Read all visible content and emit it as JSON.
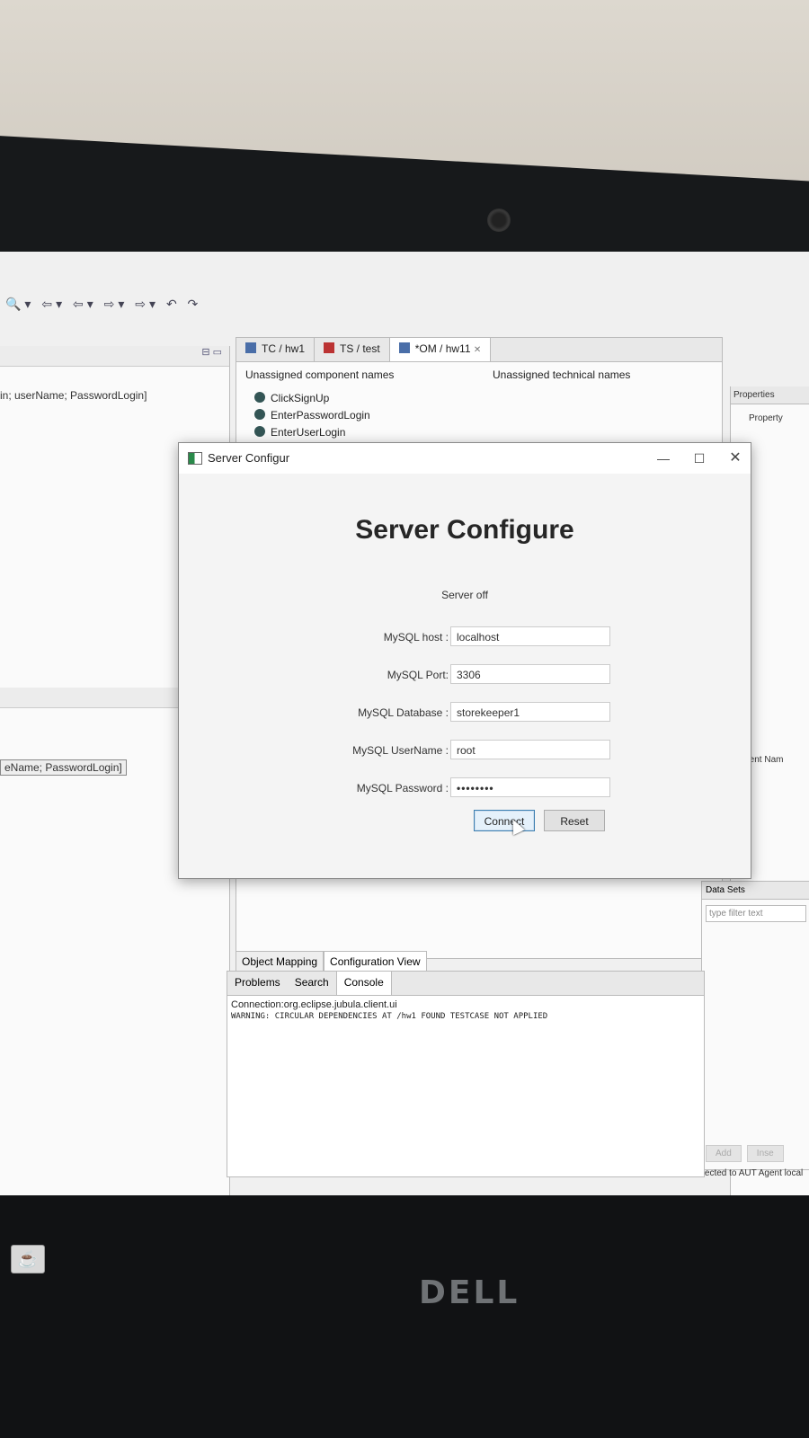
{
  "ide": {
    "left_panel": {
      "text_top": "in; userName; PasswordLogin]",
      "text_bottom": "eName; PasswordLogin]"
    },
    "editor_tabs": [
      {
        "label": "TC / hw1"
      },
      {
        "label": "TS / test"
      },
      {
        "label": "*OM / hw11",
        "close": "✕"
      }
    ],
    "unassigned_component_names": "Unassigned component names",
    "unassigned_technical_names": "Unassigned technical names",
    "components": [
      "ClickSignUp",
      "EnterPasswordLogin",
      "EnterUserLogin"
    ],
    "properties_tab": "Properties",
    "property_header": "Property",
    "component_name_partial": "ponent Nam",
    "bottom_tabs": [
      "Object Mapping",
      "Configuration View"
    ],
    "console_tabs": [
      "Problems",
      "Search",
      "Console"
    ],
    "console_line1": "Connection:org.eclipse.jubula.client.ui",
    "console_line2": "WARNING: CIRCULAR DEPENDENCIES AT /hw1 FOUND TESTCASE NOT APPLIED",
    "data_sets": {
      "title": "Data Sets",
      "filter_placeholder": "type filter text",
      "add_label": "Add",
      "insert_label": "Inse"
    },
    "status_text": "Connected to AUT Agent local"
  },
  "dialog": {
    "window_title": "Server Configur",
    "heading": "Server Configure",
    "status": "Server off",
    "fields": [
      {
        "label": "MySQL host :",
        "value": "localhost"
      },
      {
        "label": "MySQL Port:",
        "value": "3306"
      },
      {
        "label": "MySQL Database :",
        "value": "storekeeper1"
      },
      {
        "label": "MySQL UserName :",
        "value": "root"
      },
      {
        "label": "MySQL Password :",
        "value": "••••••••"
      }
    ],
    "connect_label": "Connect",
    "reset_label": "Reset",
    "minimize_glyph": "—",
    "maximize_glyph": "☐",
    "close_glyph": "✕"
  },
  "hardware": {
    "brand": "DELL"
  }
}
